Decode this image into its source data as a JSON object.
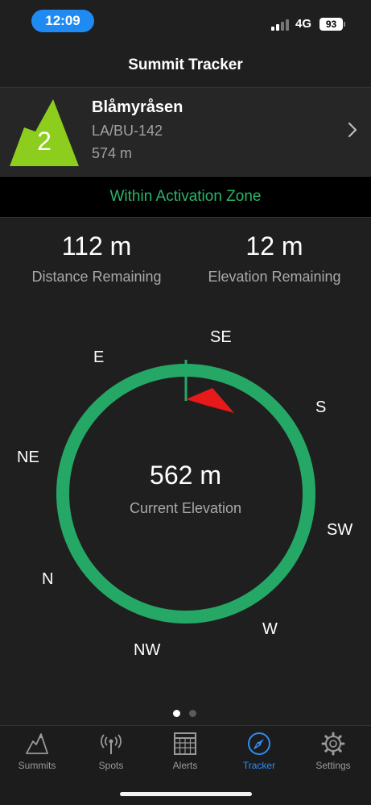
{
  "status_bar": {
    "time": "12:09",
    "network": "4G",
    "battery": "93"
  },
  "nav": {
    "title": "Summit Tracker"
  },
  "summit": {
    "number": "2",
    "name": "Blåmyråsen",
    "reference": "LA/BU-142",
    "altitude": "574 m",
    "badge_color": "#8ccd1e"
  },
  "activation": {
    "status": "Within Activation Zone",
    "color": "#2cb36a"
  },
  "stats": {
    "distance_value": "112 m",
    "distance_label": "Distance Remaining",
    "elevation_value": "12 m",
    "elevation_label": "Elevation Remaining"
  },
  "compass": {
    "directions": [
      "E",
      "SE",
      "S",
      "SW",
      "W",
      "NW",
      "N",
      "NE"
    ],
    "ring_color": "#25a865",
    "arrow_color": "#e61a1a",
    "current_elevation_value": "562 m",
    "current_elevation_label": "Current Elevation"
  },
  "pager": {
    "pages": 2,
    "current": 1
  },
  "tabs": [
    {
      "label": "Summits",
      "icon": "mountain-icon"
    },
    {
      "label": "Spots",
      "icon": "antenna-icon"
    },
    {
      "label": "Alerts",
      "icon": "calendar-icon"
    },
    {
      "label": "Tracker",
      "icon": "compass-icon",
      "active": true
    },
    {
      "label": "Settings",
      "icon": "gear-icon"
    }
  ]
}
